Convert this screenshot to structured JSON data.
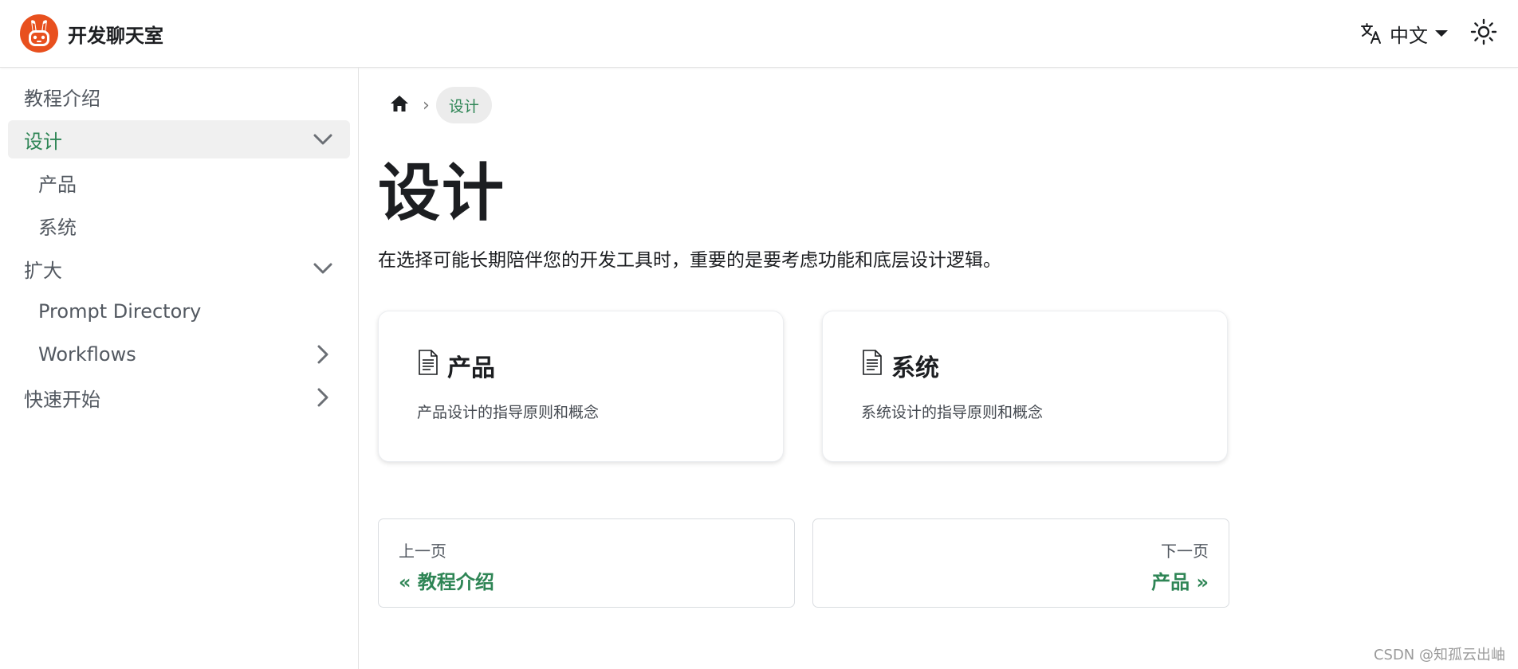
{
  "header": {
    "brand_title": "开发聊天室",
    "language_label": "中文",
    "translate_icon": "translate-icon",
    "theme_icon": "sun-icon"
  },
  "sidebar": {
    "items": [
      {
        "label": "教程介绍"
      },
      {
        "label": "设计",
        "chevron": "chevron-down-icon"
      },
      {
        "label": "产品"
      },
      {
        "label": "系统"
      },
      {
        "label": "扩大",
        "chevron": "chevron-down-icon"
      },
      {
        "label": "Prompt Directory"
      },
      {
        "label": "Workflows",
        "chevron": "chevron-right-icon"
      },
      {
        "label": "快速开始",
        "chevron": "chevron-right-icon"
      }
    ]
  },
  "breadcrumb": {
    "home_icon": "home-icon",
    "separator": "›",
    "current": "设计"
  },
  "main": {
    "title": "设计",
    "description": "在选择可能长期陪伴您的开发工具时，重要的是要考虑功能和底层设计逻辑。",
    "cards": [
      {
        "title": "产品",
        "description": "产品设计的指导原则和概念",
        "icon": "document-icon"
      },
      {
        "title": "系统",
        "description": "系统设计的指导原则和概念",
        "icon": "document-icon"
      }
    ]
  },
  "pagination": {
    "prev": {
      "sub_label": "上一页",
      "label": "« 教程介绍"
    },
    "next": {
      "sub_label": "下一页",
      "label": "产品 »"
    }
  },
  "watermark": "CSDN @知孤云出岫",
  "colors": {
    "accent": "#2e8555",
    "logo": "#e8501e",
    "active_bg": "#f0f0f0"
  }
}
